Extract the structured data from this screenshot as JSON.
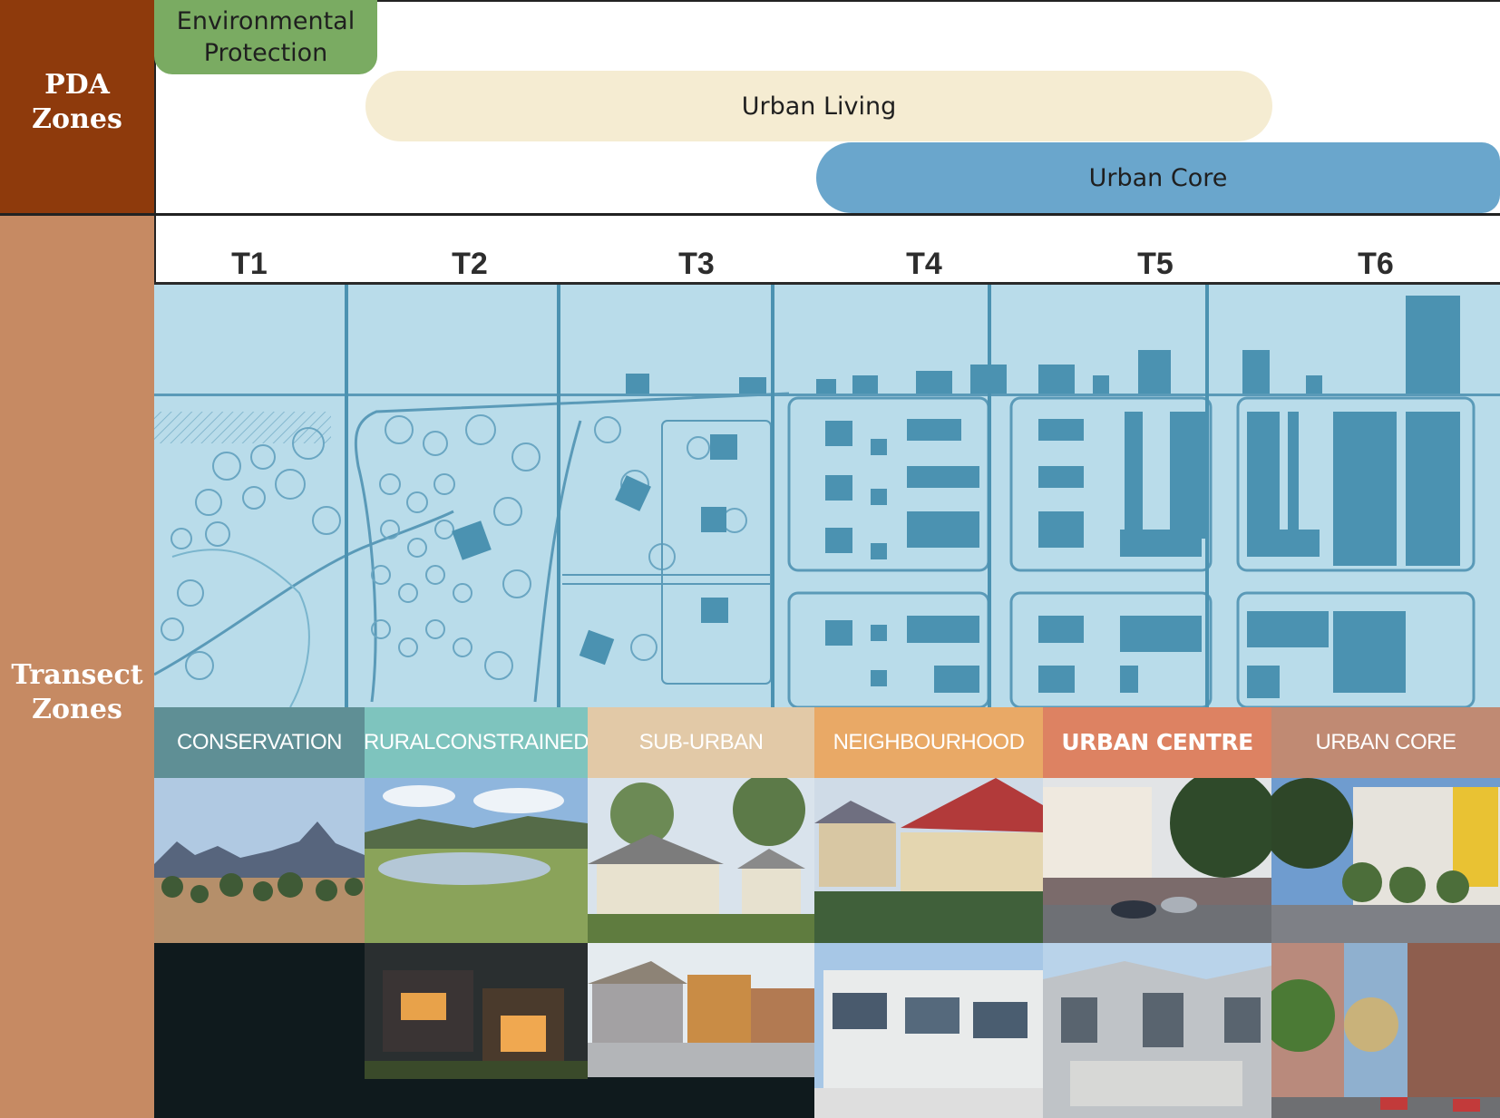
{
  "sidebar": {
    "pda": [
      "PDA",
      "Zones"
    ],
    "transect": [
      "Transect",
      "Zones"
    ]
  },
  "pda_zones": {
    "environmental": [
      "Environmental",
      "Protection"
    ],
    "urban_living": "Urban Living",
    "urban_core": "Urban Core"
  },
  "transects": [
    {
      "code": "T1",
      "name": [
        "CONSERVATION"
      ],
      "color": "#5f8f95"
    },
    {
      "code": "T2",
      "name": [
        "RURAL",
        "CONSTRAINED"
      ],
      "color": "#7ec4be"
    },
    {
      "code": "T3",
      "name": [
        "SUB-URBAN"
      ],
      "color": "#e2c9a7"
    },
    {
      "code": "T4",
      "name": [
        "NEIGHBOURHOOD"
      ],
      "color": "#e9a966"
    },
    {
      "code": "T5",
      "name": [
        "URBAN CENTRE"
      ],
      "color": "#dd8262"
    },
    {
      "code": "T6",
      "name": [
        "URBAN CORE"
      ],
      "color": "#c08a73"
    }
  ],
  "colors": {
    "pda_sidebar": "#8e3a0c",
    "transect_sidebar": "#c68a63",
    "environmental": "#7aab62",
    "urban_living": "#f5ecd2",
    "urban_core": "#6aa6cc",
    "plan_background": "#b9dcea",
    "plan_ink": "#4b92b1"
  }
}
